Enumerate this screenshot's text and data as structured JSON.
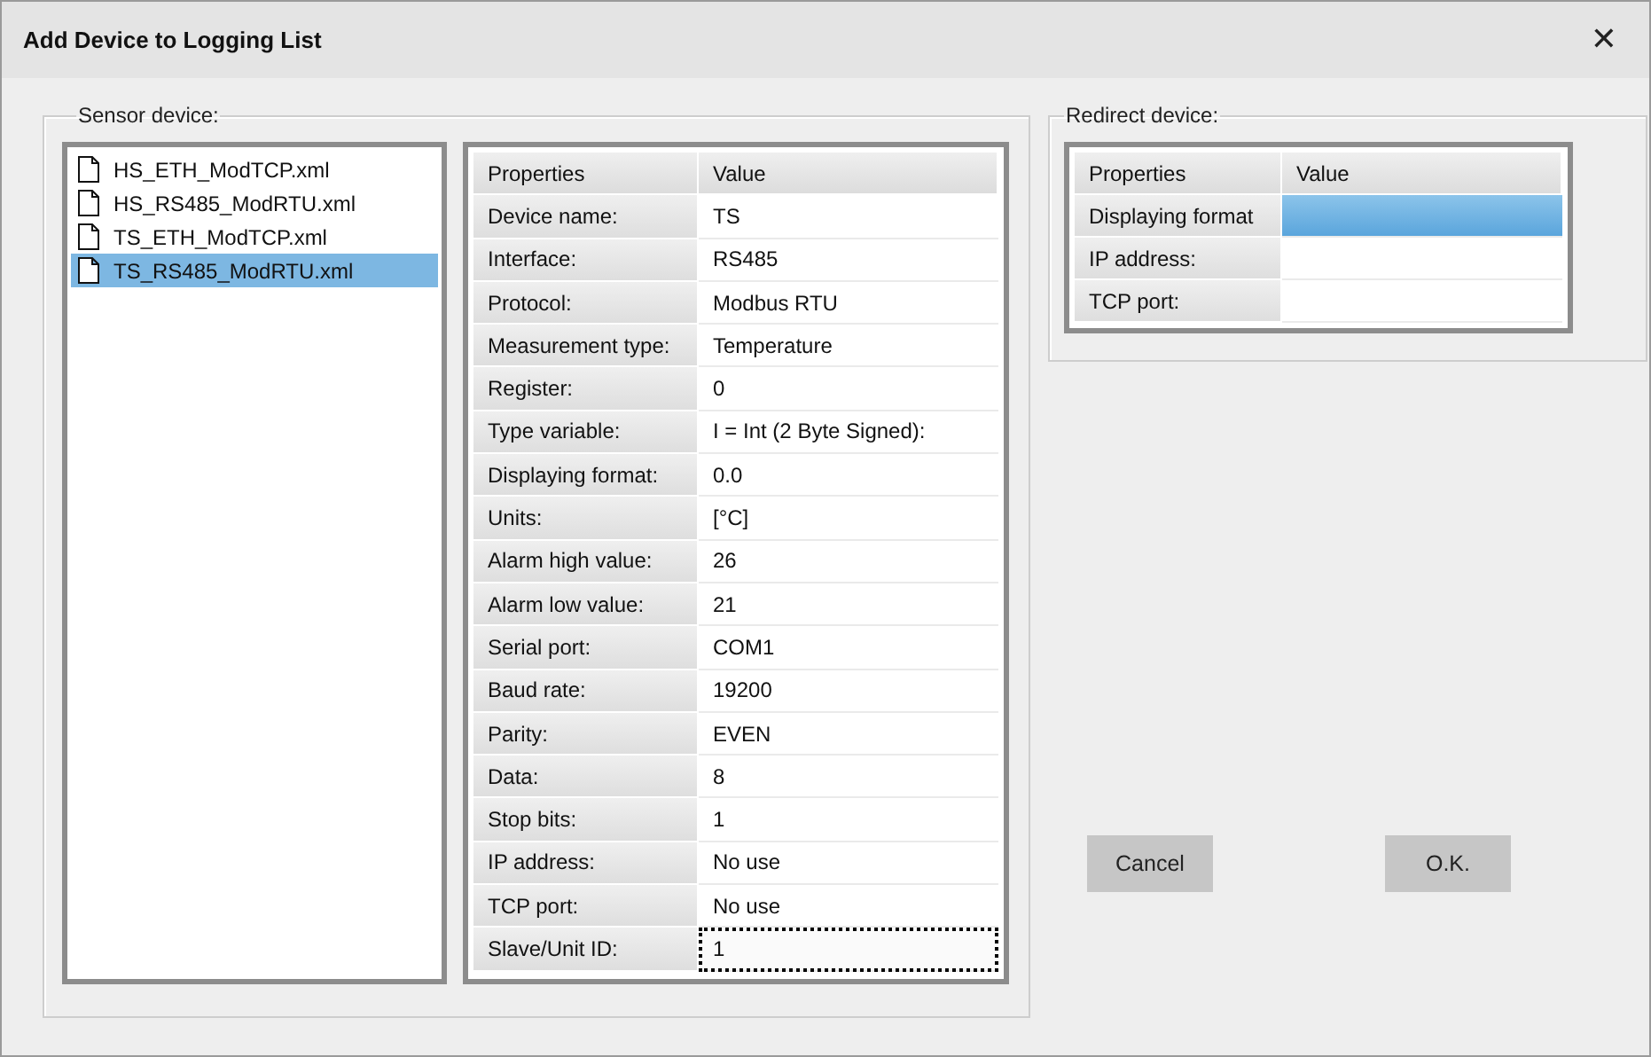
{
  "window": {
    "title": "Add Device to Logging List",
    "close": "✕"
  },
  "sensor_device": {
    "label": "Sensor device:",
    "files": [
      {
        "name": "HS_ETH_ModTCP.xml",
        "selected": false
      },
      {
        "name": "HS_RS485_ModRTU.xml",
        "selected": false
      },
      {
        "name": "TS_ETH_ModTCP.xml",
        "selected": false
      },
      {
        "name": "TS_RS485_ModRTU.xml",
        "selected": true
      }
    ],
    "table": {
      "columns": [
        "Properties",
        "Value"
      ],
      "rows": [
        {
          "property": "Device name:",
          "value": "TS",
          "focused": false
        },
        {
          "property": "Interface:",
          "value": "RS485",
          "focused": false
        },
        {
          "property": "Protocol:",
          "value": "Modbus RTU",
          "focused": false
        },
        {
          "property": "Measurement type:",
          "value": "Temperature",
          "focused": false
        },
        {
          "property": "Register:",
          "value": "0",
          "focused": false
        },
        {
          "property": "Type variable:",
          "value": "I = Int (2 Byte Signed):",
          "focused": false
        },
        {
          "property": "Displaying format:",
          "value": "0.0",
          "focused": false
        },
        {
          "property": "Units:",
          "value": "[°C]",
          "focused": false
        },
        {
          "property": "Alarm high value:",
          "value": "26",
          "focused": false
        },
        {
          "property": "Alarm low value:",
          "value": "21",
          "focused": false
        },
        {
          "property": "Serial port:",
          "value": "COM1",
          "focused": false
        },
        {
          "property": "Baud rate:",
          "value": "19200",
          "focused": false
        },
        {
          "property": "Parity:",
          "value": "EVEN",
          "focused": false
        },
        {
          "property": "Data:",
          "value": "8",
          "focused": false
        },
        {
          "property": "Stop bits:",
          "value": "1",
          "focused": false
        },
        {
          "property": "IP address:",
          "value": "No use",
          "focused": false
        },
        {
          "property": "TCP port:",
          "value": "No use",
          "focused": false
        },
        {
          "property": "Slave/Unit ID:",
          "value": "1",
          "focused": true
        }
      ]
    }
  },
  "redirect_device": {
    "label": "Redirect device:",
    "table": {
      "columns": [
        "Properties",
        "Value"
      ],
      "rows": [
        {
          "property": "Displaying format",
          "selected": true
        },
        {
          "property": "IP address:",
          "selected": false
        },
        {
          "property": "TCP port:",
          "selected": false
        }
      ]
    }
  },
  "buttons": [
    "Cancel",
    "O.K."
  ]
}
